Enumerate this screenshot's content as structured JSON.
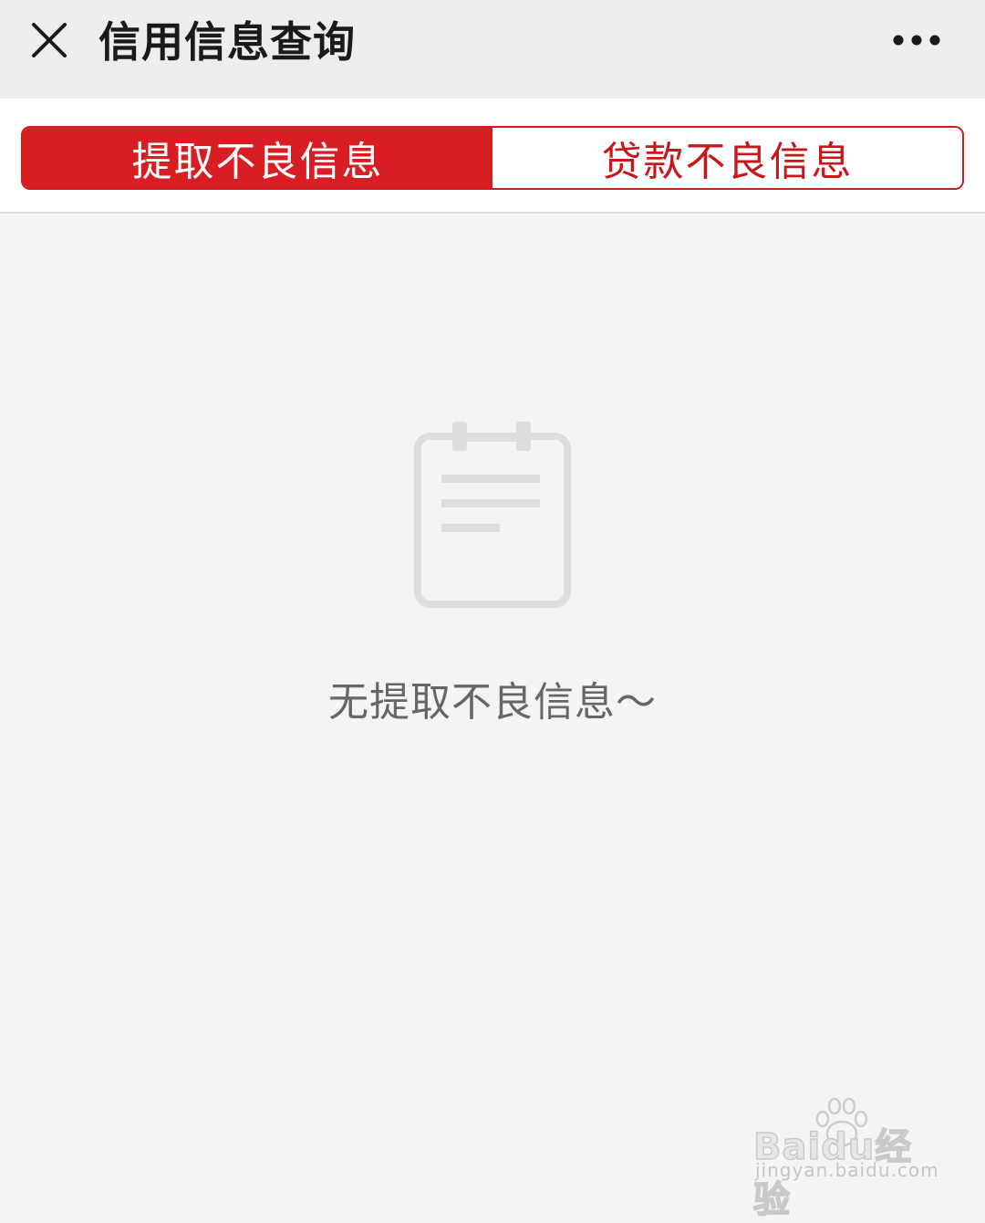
{
  "header": {
    "title": "信用信息查询",
    "close_icon": "close-icon",
    "more_icon": "more-dots-icon"
  },
  "tabs": [
    {
      "label": "提取不良信息",
      "active": true
    },
    {
      "label": "贷款不良信息",
      "active": false
    }
  ],
  "empty_state": {
    "icon": "notepad-icon",
    "message": "无提取不良信息～"
  },
  "watermark": {
    "logo": "Baidu经验",
    "url": "jingyan.baidu.com"
  },
  "colors": {
    "accent": "#d81e22",
    "header_bg": "#ededed",
    "page_bg": "#f4f4f4",
    "empty_text": "#666666",
    "empty_icon": "#dedcdc"
  }
}
